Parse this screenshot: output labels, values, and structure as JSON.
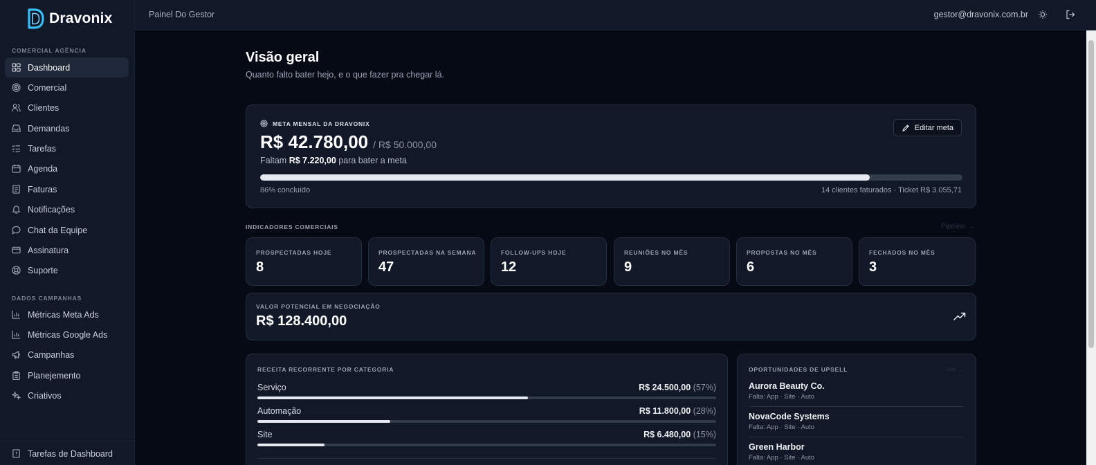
{
  "brand": {
    "name": "Dravonix",
    "accent": "#38bdf8"
  },
  "sidebar": {
    "section_comercial": "COMERCIAL AGÊNCIA",
    "section_dados": "DADOS CAMPANHAS",
    "items": [
      {
        "label": "Dashboard",
        "icon": "grid-icon"
      },
      {
        "label": "Comercial",
        "icon": "target-icon"
      },
      {
        "label": "Clientes",
        "icon": "users-icon"
      },
      {
        "label": "Demandas",
        "icon": "inbox-icon"
      },
      {
        "label": "Tarefas",
        "icon": "list-checks-icon"
      },
      {
        "label": "Agenda",
        "icon": "calendar-icon"
      },
      {
        "label": "Faturas",
        "icon": "receipt-icon"
      },
      {
        "label": "Notificações",
        "icon": "bell-icon"
      },
      {
        "label": "Chat da Equipe",
        "icon": "chat-icon"
      },
      {
        "label": "Assinatura",
        "icon": "credit-card-icon"
      },
      {
        "label": "Suporte",
        "icon": "lifebuoy-icon"
      }
    ],
    "items_dados": [
      {
        "label": "Métricas Meta Ads",
        "icon": "bar-chart-icon"
      },
      {
        "label": "Métricas Google Ads",
        "icon": "bar-chart-icon"
      },
      {
        "label": "Campanhas",
        "icon": "megaphone-icon"
      },
      {
        "label": "Planejemento",
        "icon": "clipboard-icon"
      },
      {
        "label": "Criativos",
        "icon": "sparkles-icon"
      }
    ],
    "bottom_item": "Tarefas de Dashboard"
  },
  "topbar": {
    "title": "Painel Do Gestor",
    "email": "gestor@dravonix.com.br"
  },
  "page": {
    "title": "Visão geral",
    "subtitle": "Quanto falto bater hejo, e o que fazer pra chegar lá."
  },
  "meta": {
    "label": "META MENSAL DA DRAVONIX",
    "amount": "R$ 42.780,00",
    "target": "/ R$ 50.000,00",
    "missing_prefix": "Faltam",
    "missing_value": "R$ 7.220,00",
    "missing_suffix": "para bater a meta",
    "edit_label": "Editar meta",
    "progress_percent": 86.8,
    "progress_text": "86% concluído",
    "footer_right": "14 clientes faturados · Ticket R$ 3.055,71"
  },
  "indicators": {
    "title": "INDICADORES COMERCIAIS",
    "pipeline_link": "Pipeline →",
    "kpis": [
      {
        "label": "PROSPECTADAS HOJE",
        "value": "8"
      },
      {
        "label": "PROSPECTADAS NA SEMANA",
        "value": "47"
      },
      {
        "label": "FOLLOW-UPS HOJE",
        "value": "12"
      },
      {
        "label": "REUNIÕES NO MÊS",
        "value": "9"
      },
      {
        "label": "PROPOSTAS NO MÊS",
        "value": "6"
      },
      {
        "label": "FECHADOS NO MÊS",
        "value": "3"
      }
    ],
    "potential_label": "VALOR POTENCIAL EM NEGOCIAÇÃO",
    "potential_value": "R$ 128.400,00"
  },
  "revenue": {
    "title": "RECEITA RECORRENTE POR CATEGORIA",
    "rows": [
      {
        "name": "Serviço",
        "value": "R$ 24.500,00",
        "pct": "(57%)",
        "fill": 0.59
      },
      {
        "name": "Automação",
        "value": "R$ 11.800,00",
        "pct": "(28%)",
        "fill": 0.29
      },
      {
        "name": "Site",
        "value": "R$ 6.480,00",
        "pct": "(15%)",
        "fill": 0.146
      }
    ]
  },
  "upsell": {
    "title": "OPORTUNIDADES DE UPSELL",
    "link": "Ver →",
    "items": [
      {
        "name": "Aurora Beauty Co.",
        "missing": "Falta: App · Site · Auto"
      },
      {
        "name": "NovaCode Systems",
        "missing": "Falta: App · Site · Auto"
      },
      {
        "name": "Green Harbor",
        "missing": "Falta: App · Site · Auto"
      }
    ]
  }
}
